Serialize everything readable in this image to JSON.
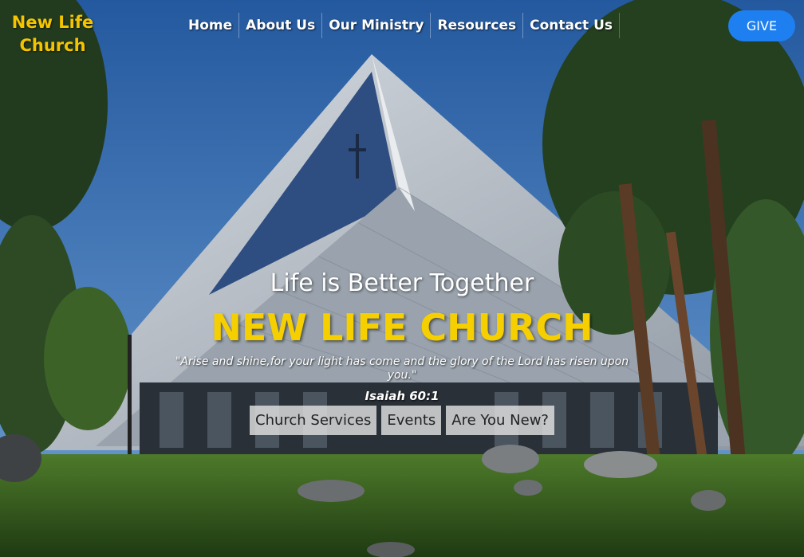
{
  "brand": {
    "logo_line1": "New Life",
    "logo_line2": "Church"
  },
  "nav": {
    "items": [
      {
        "label": "Home"
      },
      {
        "label": "About Us"
      },
      {
        "label": "Our Ministry"
      },
      {
        "label": "Resources"
      },
      {
        "label": "Contact Us"
      }
    ]
  },
  "give_label": "GIVE",
  "hero": {
    "tagline": "Life is Better Together",
    "title": "NEW LIFE CHURCH",
    "verse": "\"Arise and shine,for your light has come and the glory of the Lord has risen upon you.\"",
    "verse_ref": "Isaiah 60:1",
    "buttons": [
      {
        "label": "Church Services"
      },
      {
        "label": "Events"
      },
      {
        "label": "Are You New?"
      }
    ]
  },
  "colors": {
    "accent_yellow": "#f5cf00",
    "give_blue": "#1e7ff0",
    "sky_blue": "#3b6fb0"
  }
}
